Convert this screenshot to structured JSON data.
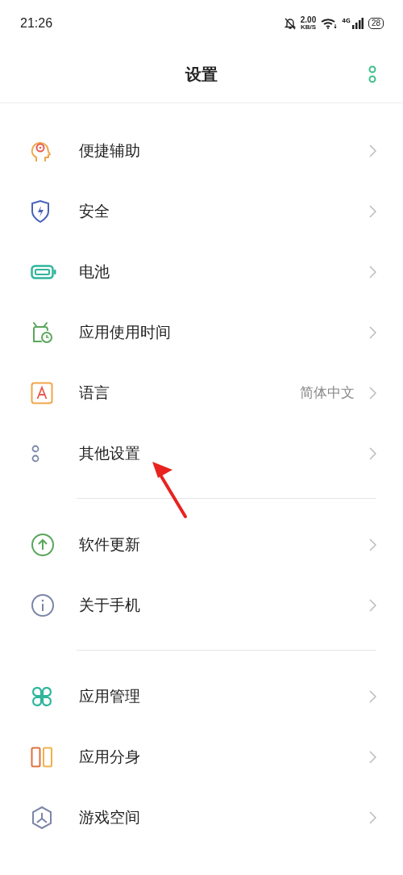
{
  "status_bar": {
    "time": "21:26",
    "net_speed": "2.00",
    "net_unit": "KB/S",
    "network": "4G",
    "battery": "28"
  },
  "header": {
    "title": "设置"
  },
  "groups": [
    {
      "items": [
        {
          "label": "便捷辅助"
        },
        {
          "label": "安全"
        },
        {
          "label": "电池"
        },
        {
          "label": "应用使用时间"
        },
        {
          "label": "语言",
          "value": "简体中文"
        },
        {
          "label": "其他设置"
        }
      ]
    },
    {
      "items": [
        {
          "label": "软件更新"
        },
        {
          "label": "关于手机"
        }
      ]
    },
    {
      "items": [
        {
          "label": "应用管理"
        },
        {
          "label": "应用分身"
        },
        {
          "label": "游戏空间"
        }
      ]
    }
  ],
  "annotation": {
    "kind": "arrow"
  }
}
